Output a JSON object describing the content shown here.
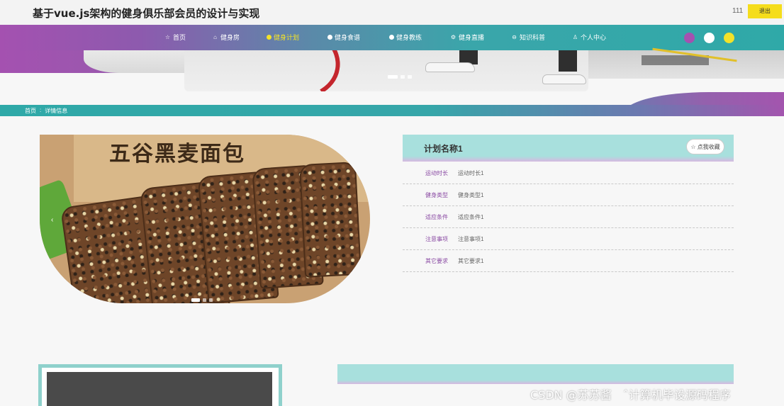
{
  "header": {
    "title": "基于vue.js架构的健身俱乐部会员的设计与实现",
    "username": "111",
    "logout_label": "退出"
  },
  "nav": {
    "items": [
      {
        "label": "首页",
        "icon": "star-icon"
      },
      {
        "label": "健身房",
        "icon": "home-icon"
      },
      {
        "label": "健身计划",
        "icon": "dot-icon",
        "active": true
      },
      {
        "label": "健身食谱",
        "icon": "dot-icon"
      },
      {
        "label": "健身教练",
        "icon": "dot-icon"
      },
      {
        "label": "健身直播",
        "icon": "gear-icon"
      },
      {
        "label": "知识科普",
        "icon": "minus-circle-icon"
      },
      {
        "label": "个人中心",
        "icon": "user-icon"
      }
    ],
    "theme_colors": [
      "#a451b0",
      "#ffffff",
      "#f3e229"
    ],
    "active_color": "#f3e229"
  },
  "breadcrumb": {
    "home": "首页",
    "separator": ":",
    "current": "详情信息"
  },
  "product_image": {
    "caption": "五谷黑麦面包",
    "prev_arrow": "‹"
  },
  "detail": {
    "title": "计划名称1",
    "favorite_label": "点我收藏",
    "rows": [
      {
        "label": "运动时长",
        "value": "运动时长1"
      },
      {
        "label": "健身类型",
        "value": "健身类型1"
      },
      {
        "label": "适应条件",
        "value": "适应条件1"
      },
      {
        "label": "注意事项",
        "value": "注意事项1"
      },
      {
        "label": "其它要求",
        "value": "其它要求1"
      }
    ]
  },
  "watermark": "CSDN @苏苏酱　ˆ计算机毕设源码程序"
}
